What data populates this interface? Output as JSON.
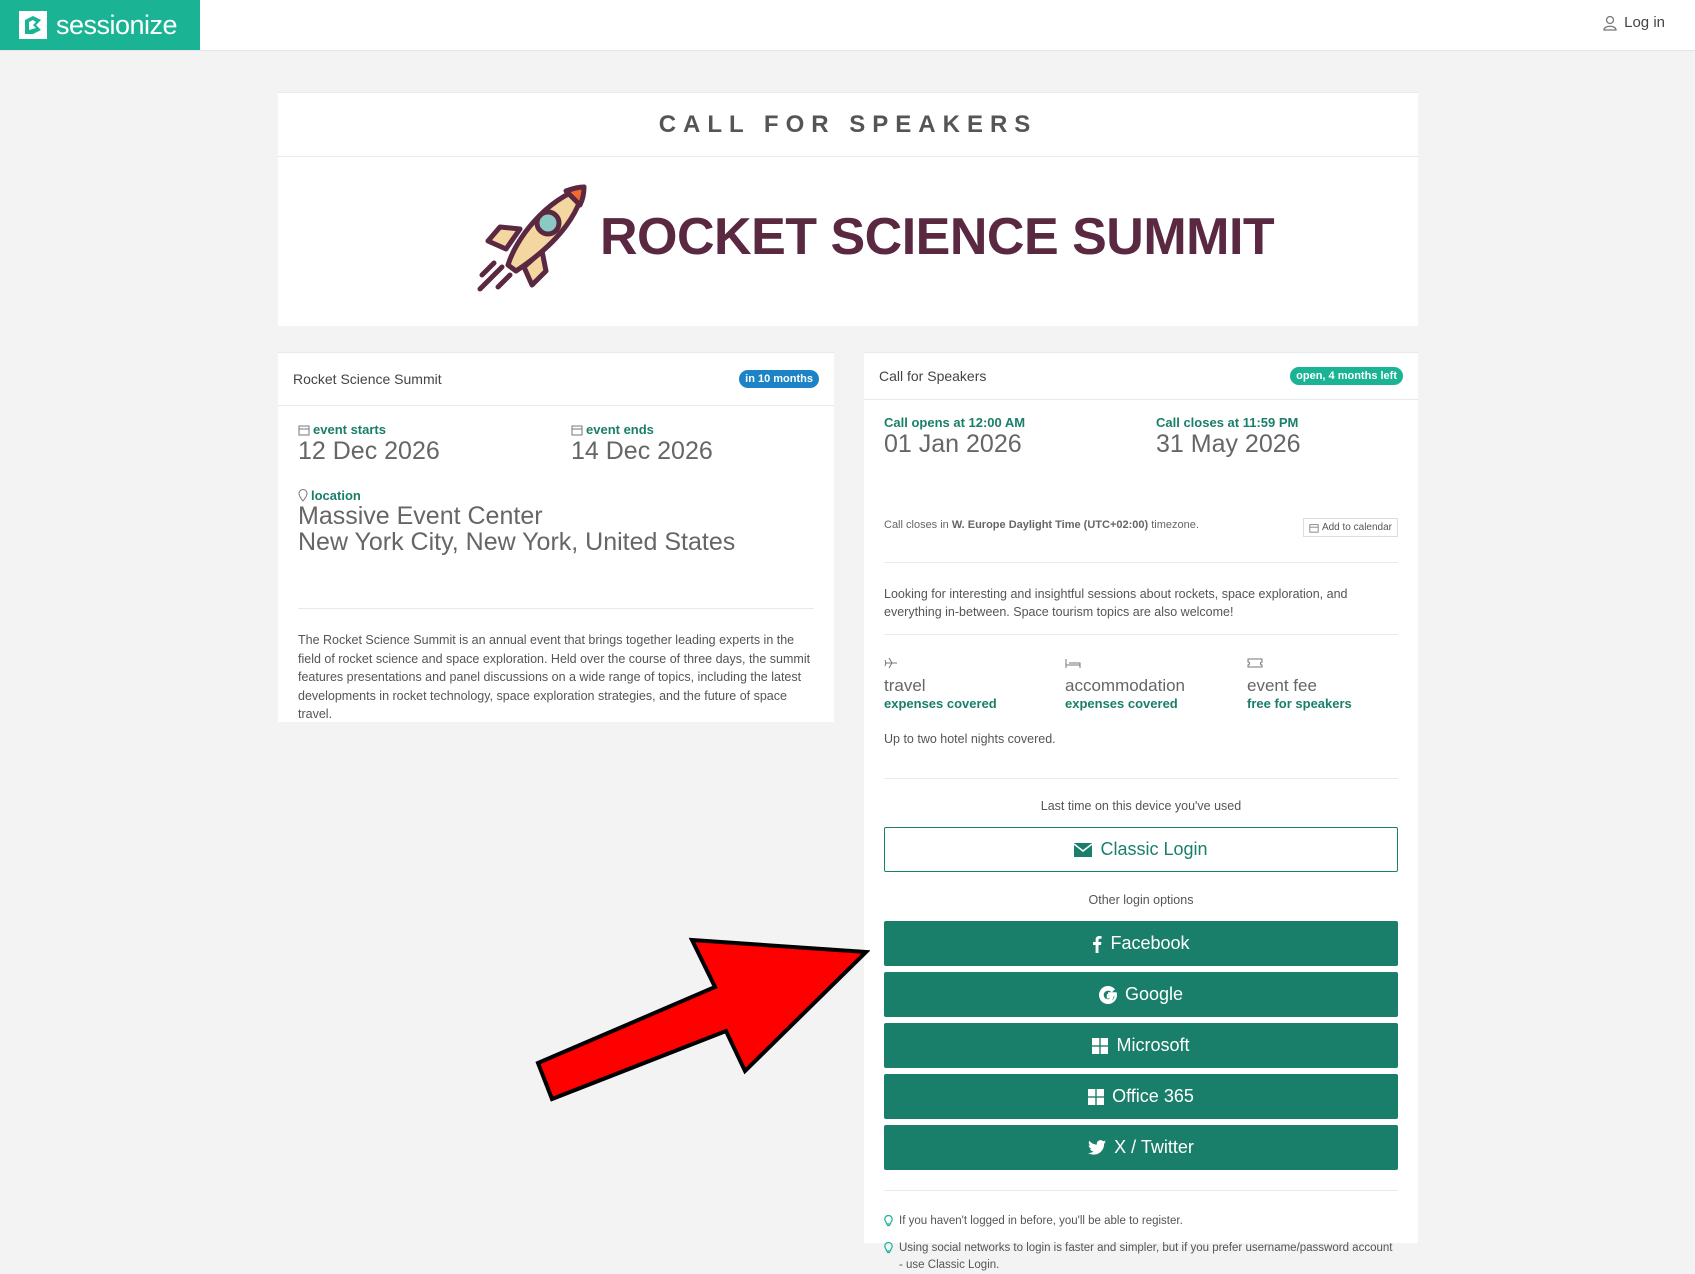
{
  "topbar": {
    "brand_name": "sessionize",
    "login_label": "Log in"
  },
  "header": {
    "title": "CALL FOR SPEAKERS",
    "banner_text": "ROCKET SCIENCE SUMMIT"
  },
  "event_card": {
    "title": "Rocket Science Summit",
    "badge": "in 10 months",
    "event_starts_label": "event starts",
    "event_starts": "12 Dec 2026",
    "event_ends_label": "event ends",
    "event_ends": "14 Dec 2026",
    "location_label": "location",
    "location_line1": "Massive Event Center",
    "location_line2": "New York City, New York, United States",
    "description": "The Rocket Science Summit is an annual event that brings together leading experts in the field of rocket science and space exploration. Held over the course of three days, the summit features presentations and panel discussions on a wide range of topics, including the latest developments in rocket technology, space exploration strategies, and the future of space travel."
  },
  "cfs_card": {
    "title": "Call for Speakers",
    "badge": "open, 4 months left",
    "opens_label": "Call opens at 12:00 AM",
    "opens_date": "01 Jan 2026",
    "closes_label": "Call closes at 11:59 PM",
    "closes_date": "31 May 2026",
    "tz_prefix": "Call closes in ",
    "tz_name": "W. Europe Daylight Time (UTC+02:00)",
    "tz_suffix": " timezone.",
    "add_to_calendar": "Add to calendar",
    "description": "Looking for interesting and insightful sessions about rockets, space exploration, and everything in-between. Space tourism topics are also welcome!",
    "benefits": [
      {
        "title": "travel",
        "sub": "expenses covered"
      },
      {
        "title": "accommodation",
        "sub": "expenses covered"
      },
      {
        "title": "event fee",
        "sub": "free for speakers"
      }
    ],
    "accommodation_note": "Up to two hotel nights covered.",
    "last_used_label": "Last time on this device you've used",
    "classic_login": "Classic Login",
    "other_options_label": "Other login options",
    "login_buttons": [
      "Facebook",
      "Google",
      "Microsoft",
      "Office 365",
      "X / Twitter"
    ],
    "tip1": "If you haven't logged in before, you'll be able to register.",
    "tip2": "Using social networks to login is faster and simpler, but if you prefer username/password account - use Classic Login."
  },
  "colors": {
    "brand": "#1ab394",
    "button": "#1a7f6a",
    "badge_blue": "#1c84c6",
    "badge_green": "#1ab394",
    "banner_text": "#5a2841",
    "arrow": "#ff0000"
  }
}
